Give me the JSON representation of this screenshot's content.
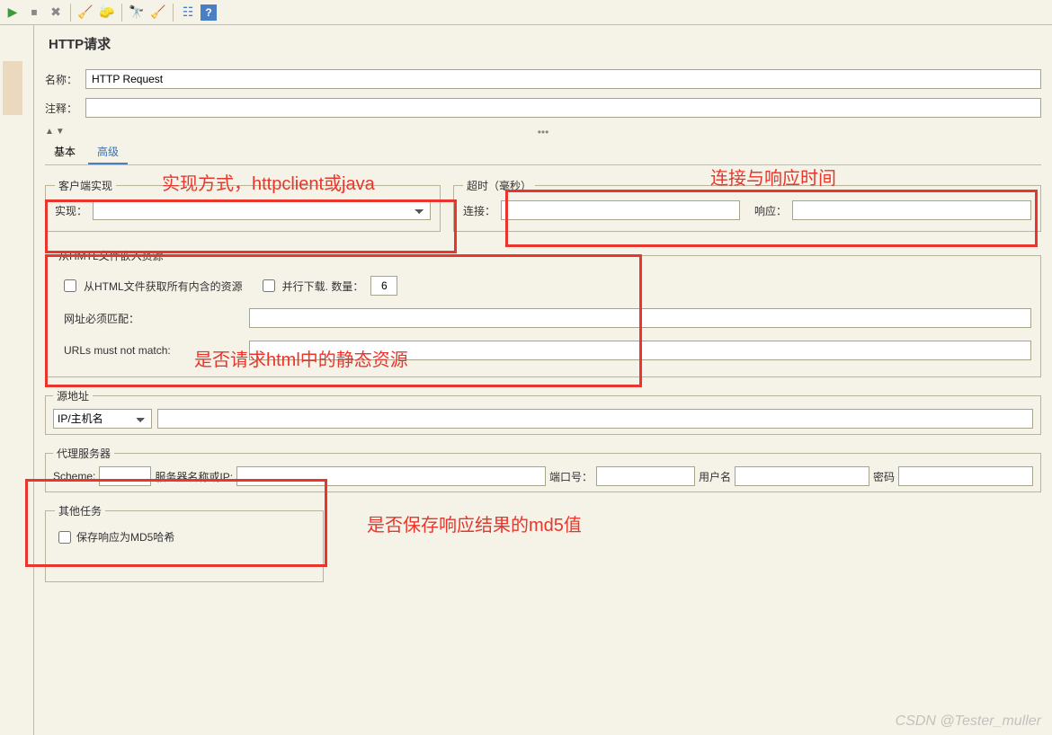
{
  "toolbar_icons": [
    "run-icon",
    "stop-icon",
    "close-icon",
    "clean-icon",
    "broom-icon",
    "binoculars-icon",
    "sweep-icon",
    "list-icon",
    "help-icon"
  ],
  "title": "HTTP请求",
  "name_label": "名称：",
  "name_value": "HTTP Request",
  "comment_label": "注释：",
  "tabs": {
    "basic": "基本",
    "advanced": "高级"
  },
  "client_impl": {
    "legend": "客户端实现",
    "impl_label": "实现："
  },
  "timeout": {
    "legend": "超时（毫秒）",
    "connect_label": "连接：",
    "response_label": "响应："
  },
  "html_resources": {
    "legend": "从HMTL文件嵌入资源",
    "checkbox1": "从HTML文件获取所有内含的资源",
    "checkbox2": "并行下载. 数量：",
    "parallel_num": "6",
    "url_match": "网址必须匹配：",
    "url_not_match": "URLs must not match:"
  },
  "source_addr": {
    "legend": "源地址",
    "combo": "IP/主机名"
  },
  "proxy": {
    "legend": "代理服务器",
    "scheme": "Scheme:",
    "server": "服务器名称或IP:",
    "port": "端口号：",
    "user": "用户名",
    "pass": "密码"
  },
  "other": {
    "legend": "其他任务",
    "md5": "保存响应为MD5哈希"
  },
  "annotations": {
    "a1": "实现方式，httpclient或java",
    "a2": "连接与响应时间",
    "a3": "是否请求html中的静态资源",
    "a4": "是否保存响应结果的md5值"
  },
  "watermark": "CSDN @Tester_muller"
}
